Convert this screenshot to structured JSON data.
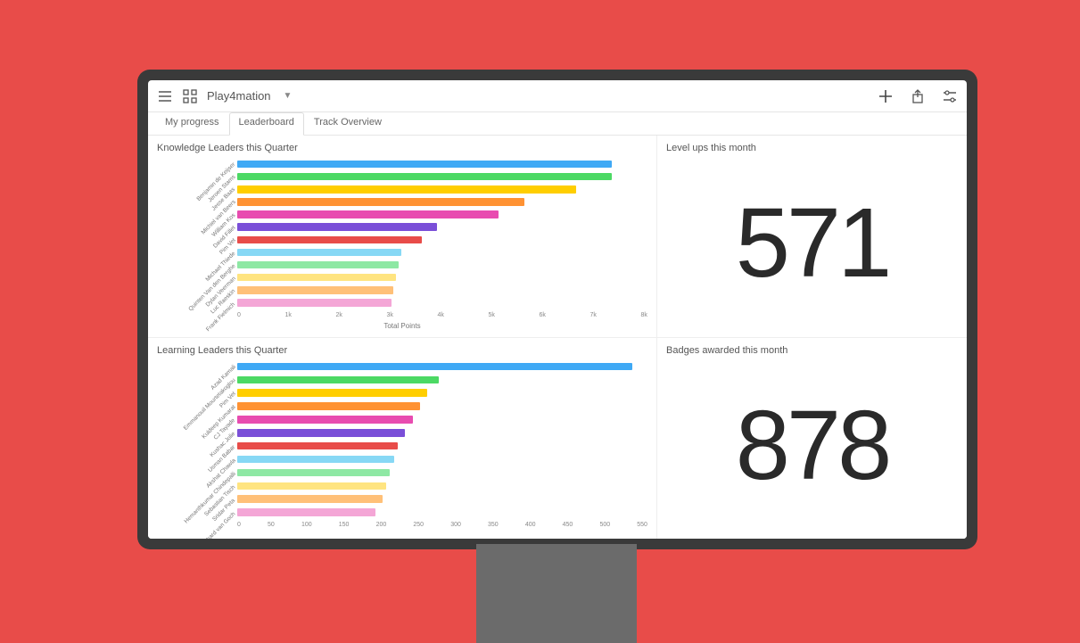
{
  "header": {
    "title": "Play4mation"
  },
  "tabs": [
    {
      "label": "My progress",
      "active": false
    },
    {
      "label": "Leaderboard",
      "active": true
    },
    {
      "label": "Track Overview",
      "active": false
    }
  ],
  "panels": {
    "knowledge": {
      "title": "Knowledge Leaders this Quarter"
    },
    "levelups": {
      "title": "Level ups this month",
      "value": "571"
    },
    "learning": {
      "title": "Learning Leaders this Quarter"
    },
    "badges": {
      "title": "Badges awarded this month",
      "value": "878"
    }
  },
  "chart_data": [
    {
      "type": "bar",
      "title": "Knowledge Leaders this Quarter",
      "xlabel": "Total Points",
      "ylabel": "",
      "xlim": [
        0,
        8000
      ],
      "xticks": [
        "0",
        "1k",
        "2k",
        "3k",
        "4k",
        "5k",
        "6k",
        "7k",
        "8k"
      ],
      "categories": [
        "Benjamin de Keijser",
        "Jeroen Stams",
        "Jesse Baas",
        "Michiel van Beers",
        "William Kos",
        "David Fillet",
        "Pim Vet",
        "Michael Thiede",
        "Quinten Van den Berghe",
        "Dylan Veerman",
        "Luc Raeskin",
        "Frank Fielmich"
      ],
      "values": [
        7300,
        7300,
        6600,
        5600,
        5100,
        3900,
        3600,
        3200,
        3150,
        3100,
        3050,
        3000
      ],
      "colors": [
        "#3fa9f5",
        "#4cd964",
        "#ffce00",
        "#ff9233",
        "#e84cb0",
        "#7a4fd8",
        "#e84c49",
        "#87d8f5",
        "#8ee8a4",
        "#ffe480",
        "#ffc078",
        "#f4a6d6"
      ]
    },
    {
      "type": "bar",
      "title": "Learning Leaders this Quarter",
      "xlabel": "",
      "ylabel": "",
      "xlim": [
        0,
        550
      ],
      "xticks": [
        "0",
        "50",
        "100",
        "150",
        "200",
        "250",
        "300",
        "350",
        "400",
        "450",
        "500",
        "550"
      ],
      "categories": [
        "Azad Kamali",
        "Emmanouil Mourtetakoglou",
        "Pim Vet",
        "Kuldeep Kumarat",
        "CJ Tayade",
        "Kushac Jolie",
        "Usman Babar",
        "Akshat Chawla",
        "Hemanthkumar Chindepalli",
        "Sebastian Tisch",
        "Sridar Peta",
        "Richard van Goch"
      ],
      "values": [
        530,
        270,
        255,
        245,
        235,
        225,
        215,
        210,
        205,
        200,
        195,
        185
      ],
      "colors": [
        "#3fa9f5",
        "#4cd964",
        "#ffce00",
        "#ff9233",
        "#e84cb0",
        "#7a4fd8",
        "#e84c49",
        "#87d8f5",
        "#8ee8a4",
        "#ffe480",
        "#ffc078",
        "#f4a6d6"
      ]
    }
  ]
}
